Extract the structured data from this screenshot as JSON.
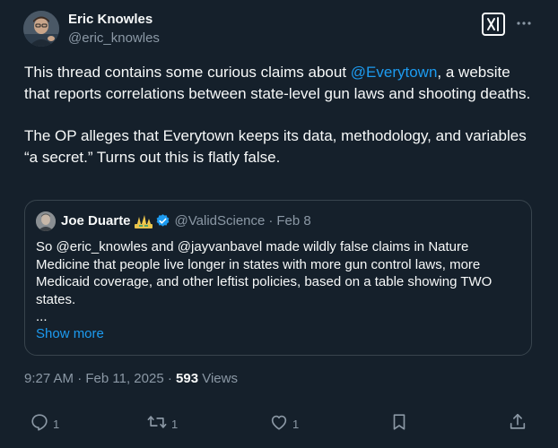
{
  "author": {
    "name": "Eric Knowles",
    "handle": "@eric_knowles"
  },
  "tweet": {
    "para1_before": "This thread contains some curious claims about ",
    "para1_mention": "@Everytown",
    "para1_after": ", a website that reports correlations between state-level gun laws and shooting deaths.",
    "para2": "The OP alleges that Everytown keeps its data, methodology, and variables “a secret.” Turns out this is flatly false."
  },
  "quote": {
    "name": "Joe Duarte",
    "emoji": "sign-language-hands-icon",
    "verified_color": "#1d9bf0",
    "handle": "@ValidScience",
    "separator": "·",
    "date": "Feb 8",
    "text": "So @eric_knowles and @jayvanbavel made wildly false claims in Nature Medicine that people live longer in states with more gun control laws, more Medicaid coverage, and other leftist policies, based on a table showing TWO states.",
    "ellipsis": "...",
    "show_more": "Show more"
  },
  "meta": {
    "time": "9:27 AM",
    "separator": " · ",
    "date": "Feb 11, 2025",
    "separator2": " · ",
    "views_count": "593",
    "views_label": " Views"
  },
  "actions": {
    "replies": "1",
    "reposts": "1",
    "likes": "1"
  },
  "colors": {
    "background": "#15202b",
    "text": "#f7f9f9",
    "secondary": "#8b98a5",
    "accent": "#1d9bf0",
    "border": "#38444d"
  }
}
